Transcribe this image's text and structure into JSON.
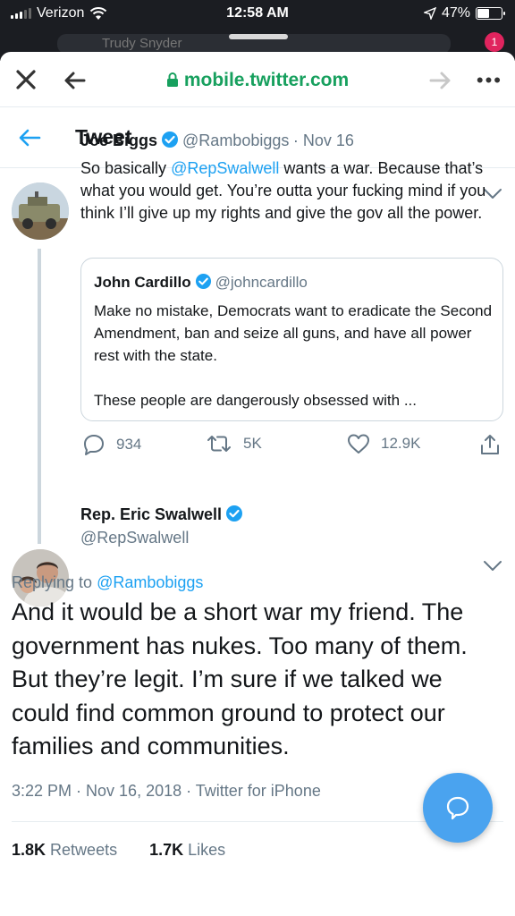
{
  "status_bar": {
    "carrier": "Verizon",
    "time": "12:58 AM",
    "battery": "47%",
    "battery_level": 0.47
  },
  "background_app": {
    "search_text": "Trudy Snyder",
    "badge": "1"
  },
  "browser": {
    "url": "mobile.twitter.com"
  },
  "header": {
    "title": "Tweet"
  },
  "tweet1": {
    "name": "Joe Biggs",
    "handle": "@Rambobiggs",
    "date": "· Nov 16",
    "text_pre": "So basically ",
    "mention": "@RepSwalwell",
    "text_post": " wants a war. Because that’s what you would get. You’re outta your fucking mind if you think I’ll give up my rights and give the gov all the power.",
    "quote": {
      "name": "John Cardillo",
      "handle": "@johncardillo",
      "para1": "Make no mistake, Democrats want to eradicate the Second Amendment, ban and seize all guns, and have all power rest with the state.",
      "para2": "These people are dangerously obsessed with ..."
    },
    "replies": "934",
    "retweets": "5K",
    "likes": "12.9K"
  },
  "tweet2": {
    "name": "Rep. Eric Swalwell",
    "handle": "@RepSwalwell",
    "replying_prefix": "Replying to ",
    "replying_to": "@Rambobiggs",
    "text": "And it would be a short war my friend. The government has nukes. Too many of them. But they’re legit. I’m sure if we talked we could find common ground to protect our families and communities.",
    "meta": "3:22 PM · Nov 16, 2018 · Twitter for iPhone",
    "retweets_count": "1.8K",
    "retweets_label": "Retweets",
    "likes_count": "1.7K",
    "likes_label": "Likes"
  },
  "colors": {
    "accent": "#1da1f2",
    "url_green": "#17a05e",
    "secondary_text": "#657786",
    "fab": "#4aa3ef"
  }
}
